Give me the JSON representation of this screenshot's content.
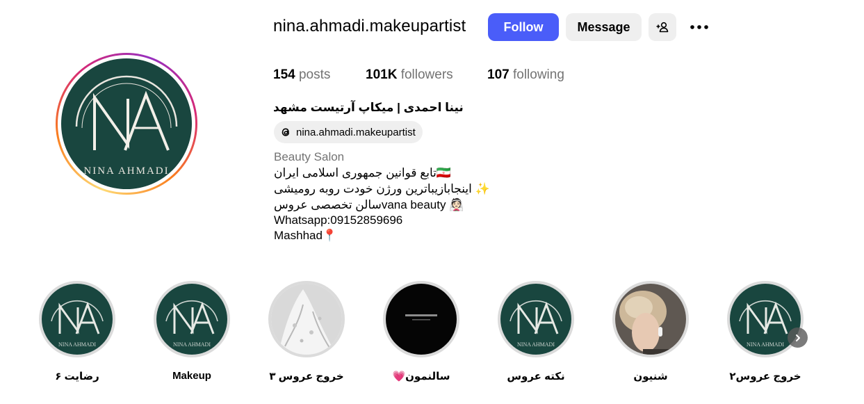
{
  "profile": {
    "username": "nina.ahmadi.makeupartist",
    "follow_label": "Follow",
    "message_label": "Message",
    "add_user_icon": "add-user-icon",
    "more_icon": "more-horizontal-icon",
    "avatar_text": "NINA AHMADI",
    "avatar_monogram": "NA"
  },
  "stats": {
    "posts_count": "154",
    "posts_label": "posts",
    "followers_count": "101K",
    "followers_label": "followers",
    "following_count": "107",
    "following_label": "following"
  },
  "bio": {
    "full_name": "نینا احمدی | میکاپ آرتیست مشهد",
    "threads_handle": "nina.ahmadi.makeupartist",
    "category": "Beauty Salon",
    "lines": [
      "تابع قوانین جمهوری اسلامی ایران🇮🇷",
      "اینجابازیباترین ورژن خودت روبه رومیشی ✨",
      "سالن تخصصی عروسvana beauty 👰🏻",
      "Whatsapp:09152859696",
      "Mashhad📍"
    ]
  },
  "highlights": [
    {
      "label": "رضایت ۶",
      "kind": "logo"
    },
    {
      "label": "Makeup",
      "kind": "logo"
    },
    {
      "label": "خروج عروس ۳",
      "kind": "dress"
    },
    {
      "label": "سالنمون💗",
      "kind": "black"
    },
    {
      "label": "نکته عروس",
      "kind": "logo"
    },
    {
      "label": "شنیون",
      "kind": "hair"
    },
    {
      "label": "خروج عروس۲",
      "kind": "logo"
    }
  ],
  "colors": {
    "accent": "#4a5df9",
    "brand_green": "#19463f",
    "muted_text": "#737373",
    "button_bg": "#efefef"
  }
}
